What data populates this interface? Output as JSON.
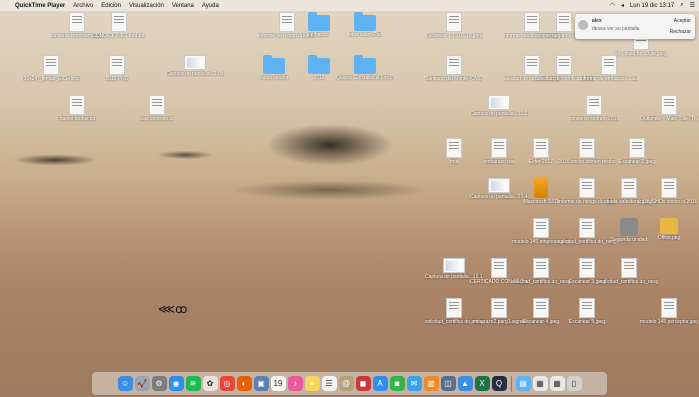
{
  "menubar": {
    "app": "QuickTime Player",
    "items": [
      "Archivo",
      "Edición",
      "Visualización",
      "Ventana",
      "Ayuda"
    ],
    "clock": "Lun 19 dic  13:17"
  },
  "notification": {
    "sender": "alex",
    "message": "desea ver su pantalla",
    "accept": "Aceptar",
    "reject": "Rechazar"
  },
  "desktop_icons": [
    {
      "label": "convenio ferroviarios.pdf",
      "kind": "doc"
    },
    {
      "label": "CONDICIONES ford.pdf",
      "kind": "doc"
    },
    {
      "label": "Informe de riesgo durante...mbarazo",
      "kind": "doc"
    },
    {
      "label": "embarazo",
      "kind": "folder"
    },
    {
      "label": "fotos sider iPad",
      "kind": "folder"
    },
    {
      "label": "Escanear 1 19.03.18.jpeg",
      "kind": "doc"
    },
    {
      "label": "informe medico de riesgo de cabecera.jpeg",
      "kind": "doc"
    },
    {
      "label": "acceso seguro de vida.jpeg",
      "kind": "doc"
    },
    {
      "label": "sit...thulo.be...0gle.jpeg",
      "kind": "doc"
    },
    {
      "label": "(30x24)_firmas_ElCertificadoTitularidad.cuc...ranja.pdf",
      "kind": "doc"
    },
    {
      "label": "2015.PNG",
      "kind": "doc"
    },
    {
      "label": "Captura de pantalla...2.05.png",
      "kind": "wide"
    },
    {
      "label": "Fotos vender",
      "kind": "folder"
    },
    {
      "label": "2016",
      "kind": "folder"
    },
    {
      "label": "Quique González & Los Dete...(ft.com)",
      "kind": "folder"
    },
    {
      "label": "Santiago del Monte (OVD)",
      "kind": "doc"
    },
    {
      "label": "solicitud de certifica...og1.jpeg",
      "kind": "doc"
    },
    {
      "label": "Solicitud de certifica...rma.jpeg",
      "kind": "doc"
    },
    {
      "label": "informe de embarazo...aia.jpeg",
      "kind": "doc"
    },
    {
      "label": "chapes bodas.pdf",
      "kind": "doc"
    },
    {
      "label": "baja contrato.txt",
      "kind": "doc"
    },
    {
      "label": "Captura de pantalla...11.21.27",
      "kind": "wide"
    },
    {
      "label": "convenio sintrafo 2018",
      "kind": "doc"
    },
    {
      "label": "Outlander - Main Title (Th...bit).mp3",
      "kind": "doc"
    },
    {
      "label": "rma",
      "kind": "doc"
    },
    {
      "label": "embarazo par",
      "kind": "doc"
    },
    {
      "label": "Elder 2017",
      "kind": "doc"
    },
    {
      "label": "2016 coche citroen recibo",
      "kind": "doc"
    },
    {
      "label": "Escanear 2.jpeg",
      "kind": "doc"
    },
    {
      "label": "Captura de pantalla...21.48.31",
      "kind": "wide"
    },
    {
      "label": "Macintosh SSD",
      "kind": "ssd"
    },
    {
      "label": "informe de riesgo durante...arazo.op",
      "kind": "doc"
    },
    {
      "label": "tabla-salesteral.jpeg",
      "kind": "doc"
    },
    {
      "label": "di38JSHOx coche ci 2016 citro",
      "kind": "doc"
    },
    {
      "label": "modelo 145 empresa.jpeg",
      "kind": "doc"
    },
    {
      "label": "solicitud_certifica do_riesg...azo_es 2",
      "kind": "doc"
    },
    {
      "label": "Segunda unidad",
      "kind": "disk"
    },
    {
      "label": "Office.pkg",
      "kind": "pkg"
    },
    {
      "label": "Captura de pantalla...12.12.02",
      "kind": "wide"
    },
    {
      "label": "CERTICADO CON FECHA.jpeg",
      "kind": "doc"
    },
    {
      "label": "solicitud_certifica do_riesg...azo_es.b",
      "kind": "doc"
    },
    {
      "label": "Escanear 3.jpeg",
      "kind": "doc"
    },
    {
      "label": "solicitud_certifica do_riesg...arazo_es",
      "kind": "doc"
    },
    {
      "label": "solicitud_certifica do_riesg...zo_es.zip",
      "kind": "doc"
    },
    {
      "label": "embarazo2.parg1.signed",
      "kind": "doc"
    },
    {
      "label": "Escanear 4.jpeg",
      "kind": "doc"
    },
    {
      "label": "Escanear 5.jpeg",
      "kind": "doc"
    },
    {
      "label": "modelo 145 perceptor.jpeg",
      "kind": "doc"
    }
  ],
  "dock": [
    {
      "name": "finder-icon",
      "color": "#3b8ee0",
      "glyph": "☺"
    },
    {
      "name": "launchpad-icon",
      "color": "#9aa4b3",
      "glyph": "🚀"
    },
    {
      "name": "system-preferences-icon",
      "color": "#7d7d7d",
      "glyph": "⚙"
    },
    {
      "name": "safari-icon",
      "color": "#2a8ff0",
      "glyph": "◉"
    },
    {
      "name": "spotify-icon",
      "color": "#1db954",
      "glyph": "≋"
    },
    {
      "name": "photos-icon",
      "color": "#e8e2d8",
      "glyph": "✿"
    },
    {
      "name": "chrome-icon",
      "color": "#e5483b",
      "glyph": "◎"
    },
    {
      "name": "firefox-icon",
      "color": "#e66000",
      "glyph": "◐"
    },
    {
      "name": "preview-icon",
      "color": "#5b7fb0",
      "glyph": "▣"
    },
    {
      "name": "calendar-icon",
      "color": "#f4f4f4",
      "glyph": "19"
    },
    {
      "name": "itunes-icon",
      "color": "#e85a9a",
      "glyph": "♪"
    },
    {
      "name": "notes-icon",
      "color": "#f4d65a",
      "glyph": "≡"
    },
    {
      "name": "reminders-icon",
      "color": "#f2f2f2",
      "glyph": "☰"
    },
    {
      "name": "contacts-icon",
      "color": "#b7a07a",
      "glyph": "@"
    },
    {
      "name": "photo-booth-icon",
      "color": "#c93a3a",
      "glyph": "◼"
    },
    {
      "name": "app-store-icon",
      "color": "#2d8ef0",
      "glyph": "A"
    },
    {
      "name": "facetime-icon",
      "color": "#36b24a",
      "glyph": "◙"
    },
    {
      "name": "messages-icon",
      "color": "#35a3f0",
      "glyph": "✉"
    },
    {
      "name": "ibooks-icon",
      "color": "#f08a24",
      "glyph": "▥"
    },
    {
      "name": "preview-photo-icon",
      "color": "#5a6f8e",
      "glyph": "◫"
    },
    {
      "name": "keynote-icon",
      "color": "#3b8ee0",
      "glyph": "▲"
    },
    {
      "name": "excel-icon",
      "color": "#1f7244",
      "glyph": "X"
    },
    {
      "name": "quicktime-icon",
      "color": "#24303f",
      "glyph": "Q"
    }
  ],
  "dock_right": [
    {
      "name": "applications-folder-icon",
      "color": "#5fb3f2",
      "glyph": "▤"
    },
    {
      "name": "documents-stack-icon",
      "color": "#e8e8e8",
      "glyph": "▦"
    },
    {
      "name": "downloads-stack-icon",
      "color": "#e8e8e8",
      "glyph": "▦"
    },
    {
      "name": "trash-icon",
      "color": "#d0d0d0",
      "glyph": "▯"
    }
  ]
}
